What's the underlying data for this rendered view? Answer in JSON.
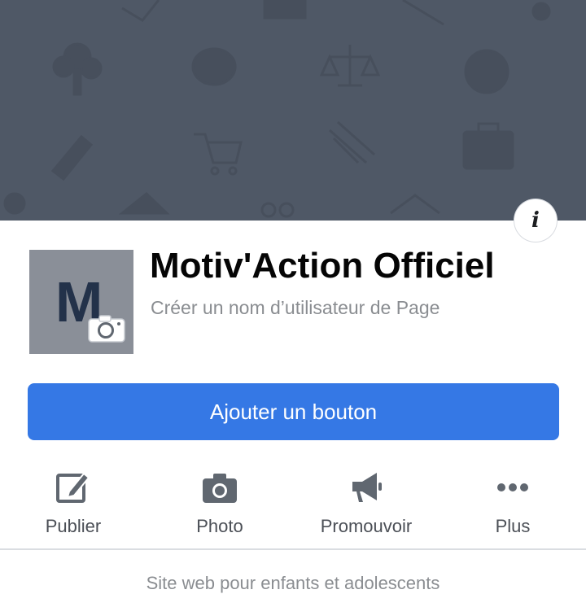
{
  "page": {
    "name": "Motiv'Action Officiel",
    "username_prompt": "Créer un nom d’utilisateur de Page",
    "avatar_letter": "M",
    "description": "Site web pour enfants et adolescents"
  },
  "cta": {
    "label": "Ajouter un bouton"
  },
  "actions": [
    {
      "label": "Publier",
      "icon": "edit-icon"
    },
    {
      "label": "Photo",
      "icon": "camera-icon"
    },
    {
      "label": "Promouvoir",
      "icon": "megaphone-icon"
    },
    {
      "label": "Plus",
      "icon": "more-icon"
    }
  ],
  "info": {
    "glyph": "i"
  },
  "colors": {
    "cover": "#4f5866",
    "accent": "#3578e5",
    "icon": "#606770",
    "avatar_bg": "#8a8f98"
  }
}
